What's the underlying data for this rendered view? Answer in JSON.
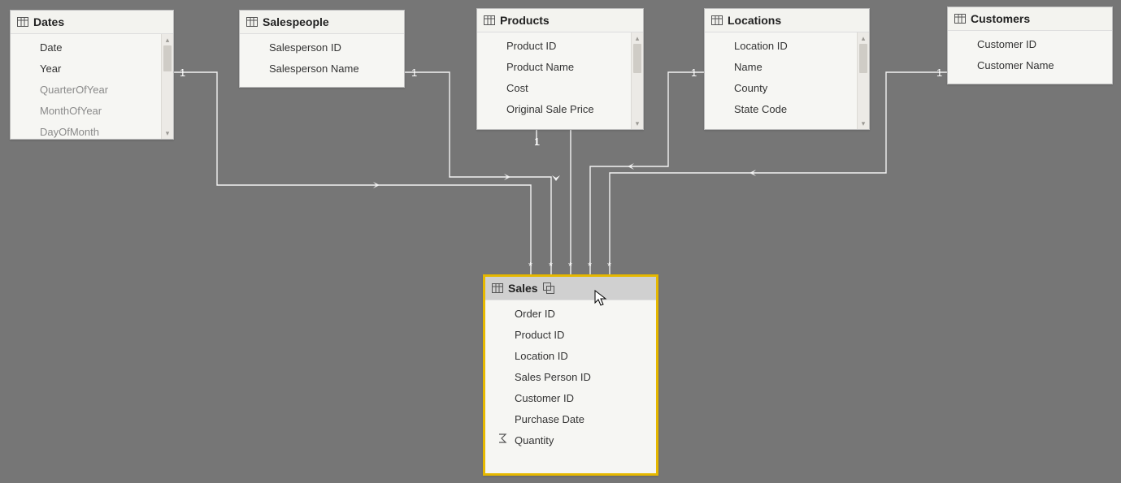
{
  "tables": {
    "dates": {
      "title": "Dates",
      "fields": [
        "Date",
        "Year",
        "QuarterOfYear",
        "MonthOfYear",
        "DayOfMonth"
      ],
      "dimFrom": 2
    },
    "salespeople": {
      "title": "Salespeople",
      "fields": [
        "Salesperson ID",
        "Salesperson Name"
      ]
    },
    "products": {
      "title": "Products",
      "fields": [
        "Product ID",
        "Product Name",
        "Cost",
        "Original Sale Price"
      ]
    },
    "locations": {
      "title": "Locations",
      "fields": [
        "Location ID",
        "Name",
        "County",
        "State Code"
      ]
    },
    "customers": {
      "title": "Customers",
      "fields": [
        "Customer ID",
        "Customer Name"
      ]
    },
    "sales": {
      "title": "Sales",
      "fields": [
        "Order ID",
        "Product ID",
        "Location ID",
        "Sales Person ID",
        "Customer ID",
        "Purchase Date",
        "Quantity"
      ],
      "aggField": "Quantity"
    }
  },
  "relationships": {
    "one_side_label": "1",
    "many_side_label": "*"
  }
}
